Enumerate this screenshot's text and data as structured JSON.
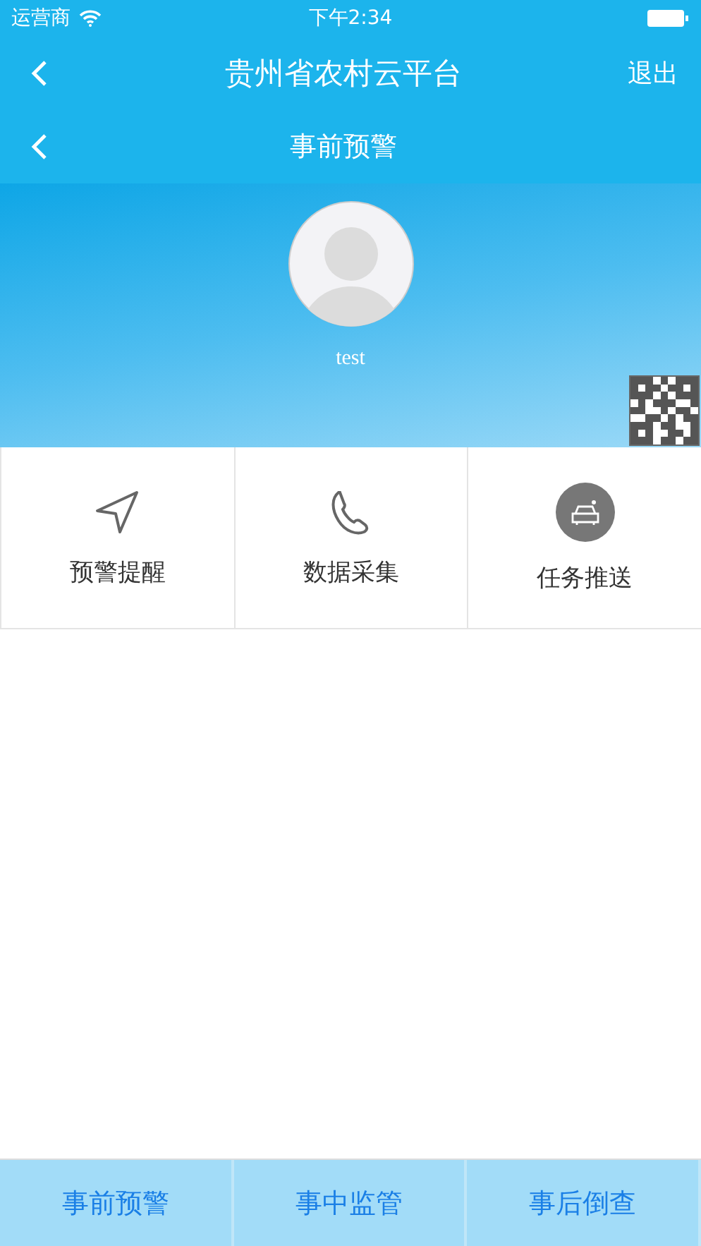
{
  "status_bar": {
    "carrier": "运营商",
    "time": "下午2:34"
  },
  "app_bar": {
    "title": "贵州省农村云平台",
    "action": "退出"
  },
  "page_bar": {
    "title": "事前预警"
  },
  "profile": {
    "username": "test"
  },
  "menu": [
    {
      "kind": "send",
      "label": "预警提醒"
    },
    {
      "kind": "phone",
      "label": "数据采集"
    },
    {
      "kind": "car",
      "label": "任务推送"
    }
  ],
  "tabs": [
    {
      "label": "事前预警",
      "selected": false
    },
    {
      "label": "事中监管",
      "selected": false
    },
    {
      "label": "事后倒查",
      "selected": false
    }
  ]
}
